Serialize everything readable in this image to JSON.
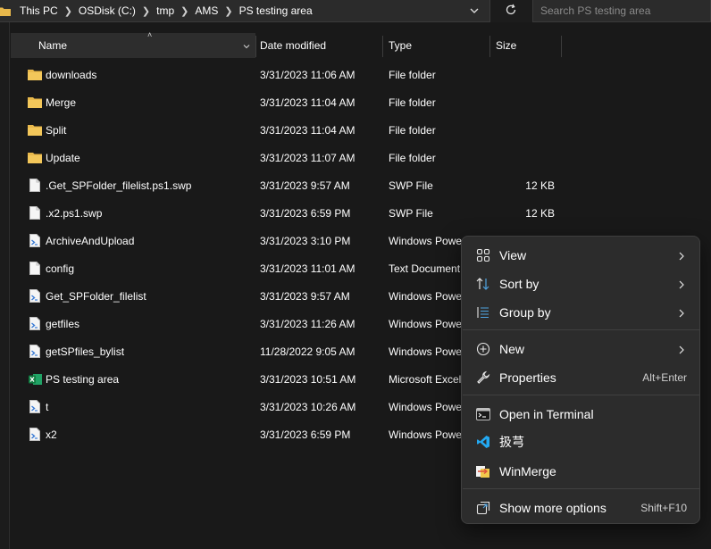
{
  "address_bar": {
    "crumbs": [
      "This PC",
      "OSDisk (C:)",
      "tmp",
      "AMS",
      "PS testing area"
    ]
  },
  "search": {
    "placeholder": "Search PS testing area"
  },
  "columns": {
    "name": "Name",
    "date": "Date modified",
    "type": "Type",
    "size": "Size"
  },
  "files": [
    {
      "icon": "folder-icon",
      "name": "downloads",
      "date": "3/31/2023 11:06 AM",
      "type": "File folder",
      "size": ""
    },
    {
      "icon": "folder-icon",
      "name": "Merge",
      "date": "3/31/2023 11:04 AM",
      "type": "File folder",
      "size": ""
    },
    {
      "icon": "folder-icon",
      "name": "Split",
      "date": "3/31/2023 11:04 AM",
      "type": "File folder",
      "size": ""
    },
    {
      "icon": "folder-icon",
      "name": "Update",
      "date": "3/31/2023 11:07 AM",
      "type": "File folder",
      "size": ""
    },
    {
      "icon": "file-icon",
      "name": ".Get_SPFolder_filelist.ps1.swp",
      "date": "3/31/2023 9:57 AM",
      "type": "SWP File",
      "size": "12 KB"
    },
    {
      "icon": "file-icon",
      "name": ".x2.ps1.swp",
      "date": "3/31/2023 6:59 PM",
      "type": "SWP File",
      "size": "12 KB"
    },
    {
      "icon": "powershell-script-icon",
      "name": "ArchiveAndUpload",
      "date": "3/31/2023 3:10 PM",
      "type": "Windows Powe",
      "size": ""
    },
    {
      "icon": "file-icon",
      "name": "config",
      "date": "3/31/2023 11:01 AM",
      "type": "Text Document",
      "size": ""
    },
    {
      "icon": "powershell-script-icon",
      "name": "Get_SPFolder_filelist",
      "date": "3/31/2023 9:57 AM",
      "type": "Windows Powe",
      "size": ""
    },
    {
      "icon": "powershell-script-icon",
      "name": "getfiles",
      "date": "3/31/2023 11:26 AM",
      "type": "Windows Powe",
      "size": ""
    },
    {
      "icon": "powershell-script-icon",
      "name": "getSPfiles_bylist",
      "date": "11/28/2022 9:05 AM",
      "type": "Windows Powe",
      "size": ""
    },
    {
      "icon": "excel-icon",
      "name": "PS testing area",
      "date": "3/31/2023 10:51 AM",
      "type": "Microsoft Excel",
      "size": ""
    },
    {
      "icon": "powershell-script-icon",
      "name": "t",
      "date": "3/31/2023 10:26 AM",
      "type": "Windows Powe",
      "size": ""
    },
    {
      "icon": "powershell-script-icon",
      "name": "x2",
      "date": "3/31/2023 6:59 PM",
      "type": "Windows Powe",
      "size": ""
    }
  ],
  "context_menu": {
    "view": "View",
    "sort_by": "Sort by",
    "group_by": "Group by",
    "new": "New",
    "properties": "Properties",
    "properties_key": "Alt+Enter",
    "open_terminal": "Open in Terminal",
    "vscode": "扱芎",
    "winmerge": "WinMerge",
    "more_options": "Show more options",
    "more_options_key": "Shift+F10"
  },
  "colors": {
    "background": "#191919",
    "menu_background": "#2c2c2c",
    "folder": "#e8b84b",
    "vscode_accent": "#23a9f2",
    "excel": "#1d7a45"
  }
}
